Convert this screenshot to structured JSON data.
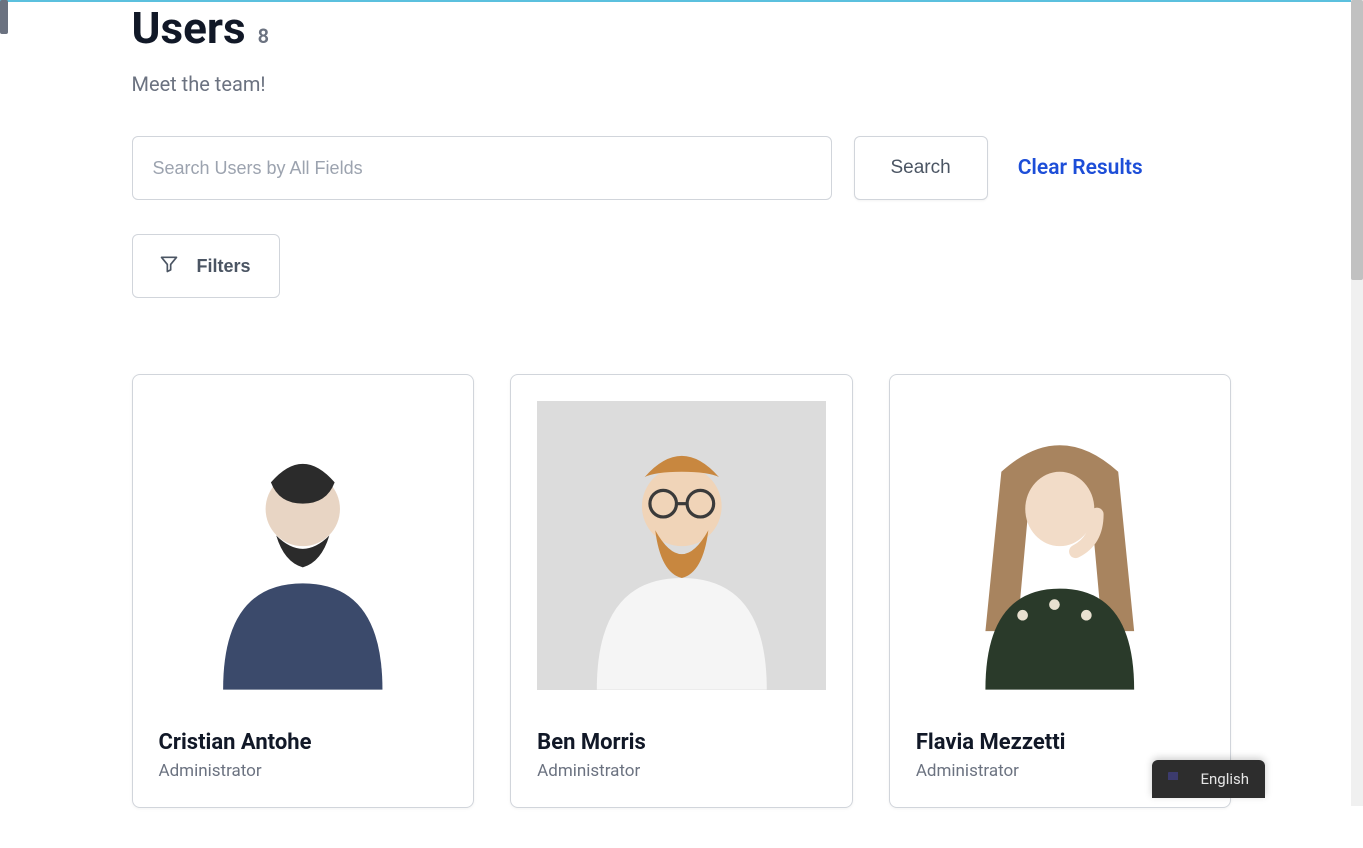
{
  "page": {
    "title": "Users",
    "count": "8",
    "subtitle": "Meet the team!"
  },
  "search": {
    "placeholder": "Search Users by All Fields",
    "button_label": "Search",
    "clear_label": "Clear Results"
  },
  "filters": {
    "button_label": "Filters"
  },
  "users": [
    {
      "name": "Cristian Antohe",
      "role": "Administrator"
    },
    {
      "name": "Ben Morris",
      "role": "Administrator"
    },
    {
      "name": "Flavia Mezzetti",
      "role": "Administrator"
    }
  ],
  "language_widget": {
    "label": "English"
  },
  "colors": {
    "accent_link": "#1d4ed8",
    "border": "#d1d5db",
    "text_muted": "#6b7280"
  }
}
